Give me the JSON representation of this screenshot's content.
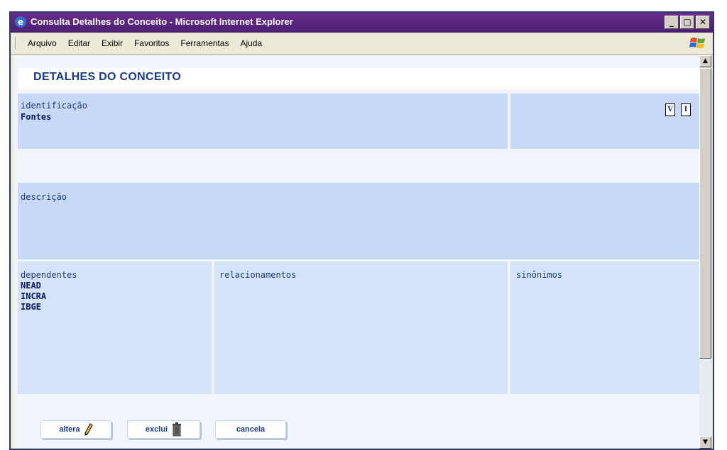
{
  "window": {
    "title": "Consulta Detalhes do Conceito - Microsoft Internet Explorer"
  },
  "menu": [
    "Arquivo",
    "Editar",
    "Exibir",
    "Favoritos",
    "Ferramentas",
    "Ajuda"
  ],
  "page": {
    "title": "DETALHES DO CONCEITO",
    "identificacao": {
      "label": "identificação",
      "value": "Fontes"
    },
    "descricao": {
      "label": "descrição"
    },
    "dependentes": {
      "label": "dependentes",
      "values": [
        "NEAD",
        "INCRA",
        "IBGE"
      ]
    },
    "relacionamentos": {
      "label": "relacionamentos"
    },
    "sinonimos": {
      "label": "sinônimos"
    }
  },
  "icons": {
    "doc_v": "V",
    "doc_i": "I"
  },
  "buttons": {
    "altera": "altera",
    "exclui": "exclui",
    "cancela": "cancela"
  }
}
